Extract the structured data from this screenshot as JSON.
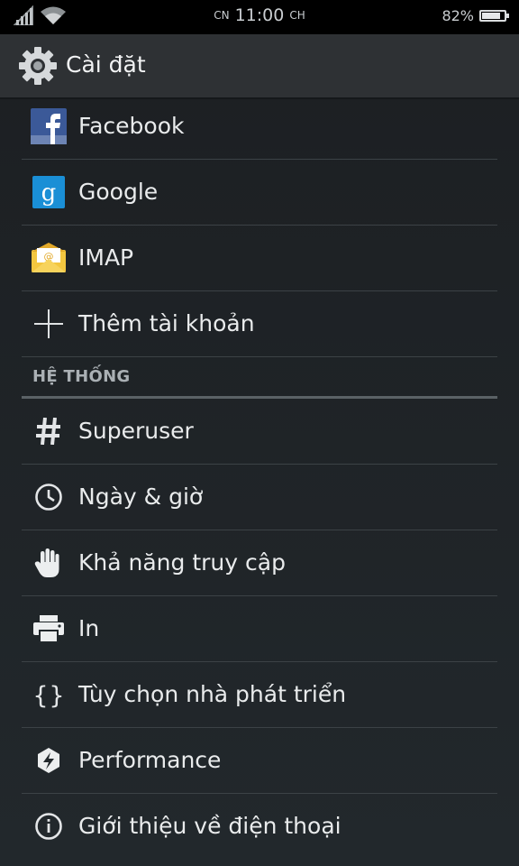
{
  "status_bar": {
    "am_pm_prefix": "CN",
    "time": "11:00",
    "am_pm_suffix": "CH",
    "battery_percent_text": "82%",
    "battery_level": 0.82
  },
  "action_bar": {
    "icon": "gear-icon",
    "title": "Cài đặt"
  },
  "accounts": [
    {
      "icon": "facebook-icon",
      "label": "Facebook"
    },
    {
      "icon": "google-icon",
      "label": "Google"
    },
    {
      "icon": "imap-mail-icon",
      "label": "IMAP"
    },
    {
      "icon": "plus-icon",
      "label": "Thêm tài khoản"
    }
  ],
  "system_section": {
    "header": "HỆ THỐNG",
    "items": [
      {
        "icon": "hash-icon",
        "label": "Superuser"
      },
      {
        "icon": "clock-icon",
        "label": "Ngày & giờ"
      },
      {
        "icon": "hand-icon",
        "label": "Khả năng truy cập"
      },
      {
        "icon": "printer-icon",
        "label": "In"
      },
      {
        "icon": "braces-icon",
        "label": "Tùy chọn nhà phát triển"
      },
      {
        "icon": "performance-bolt-icon",
        "label": "Performance"
      },
      {
        "icon": "info-icon",
        "label": "Giới thiệu về điện thoại"
      }
    ]
  },
  "colors": {
    "facebook_blue": "#3b5998",
    "google_blue": "#1a8fd6",
    "imap_yellow": "#f3c63f"
  }
}
